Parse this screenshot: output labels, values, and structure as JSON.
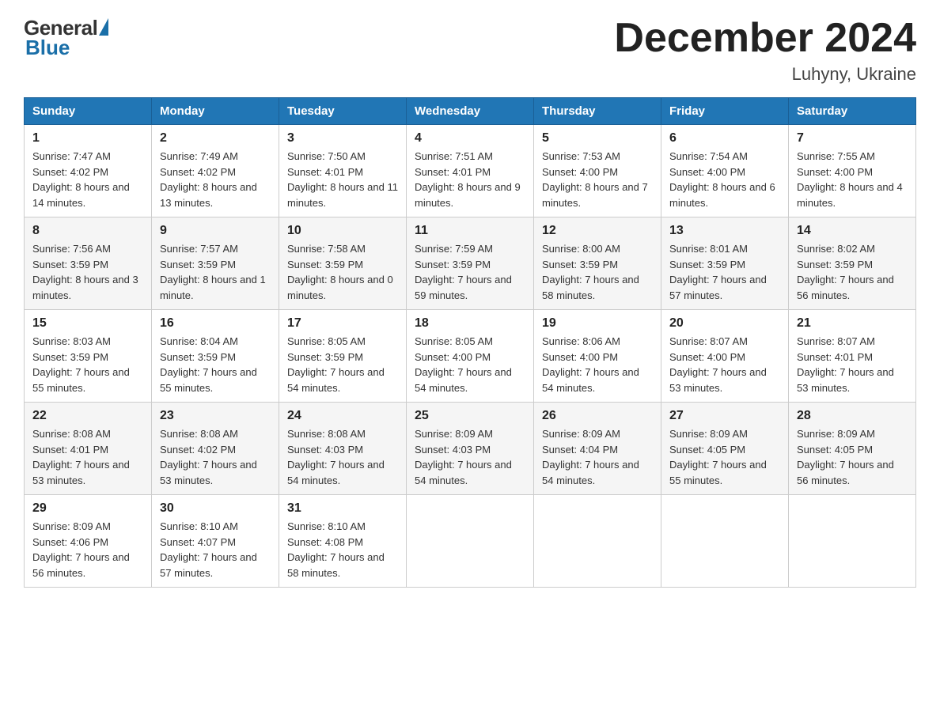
{
  "logo": {
    "general": "General",
    "blue": "Blue"
  },
  "title": "December 2024",
  "location": "Luhyny, Ukraine",
  "days_of_week": [
    "Sunday",
    "Monday",
    "Tuesday",
    "Wednesday",
    "Thursday",
    "Friday",
    "Saturday"
  ],
  "weeks": [
    [
      {
        "day": "1",
        "sunrise": "7:47 AM",
        "sunset": "4:02 PM",
        "daylight": "8 hours and 14 minutes."
      },
      {
        "day": "2",
        "sunrise": "7:49 AM",
        "sunset": "4:02 PM",
        "daylight": "8 hours and 13 minutes."
      },
      {
        "day": "3",
        "sunrise": "7:50 AM",
        "sunset": "4:01 PM",
        "daylight": "8 hours and 11 minutes."
      },
      {
        "day": "4",
        "sunrise": "7:51 AM",
        "sunset": "4:01 PM",
        "daylight": "8 hours and 9 minutes."
      },
      {
        "day": "5",
        "sunrise": "7:53 AM",
        "sunset": "4:00 PM",
        "daylight": "8 hours and 7 minutes."
      },
      {
        "day": "6",
        "sunrise": "7:54 AM",
        "sunset": "4:00 PM",
        "daylight": "8 hours and 6 minutes."
      },
      {
        "day": "7",
        "sunrise": "7:55 AM",
        "sunset": "4:00 PM",
        "daylight": "8 hours and 4 minutes."
      }
    ],
    [
      {
        "day": "8",
        "sunrise": "7:56 AM",
        "sunset": "3:59 PM",
        "daylight": "8 hours and 3 minutes."
      },
      {
        "day": "9",
        "sunrise": "7:57 AM",
        "sunset": "3:59 PM",
        "daylight": "8 hours and 1 minute."
      },
      {
        "day": "10",
        "sunrise": "7:58 AM",
        "sunset": "3:59 PM",
        "daylight": "8 hours and 0 minutes."
      },
      {
        "day": "11",
        "sunrise": "7:59 AM",
        "sunset": "3:59 PM",
        "daylight": "7 hours and 59 minutes."
      },
      {
        "day": "12",
        "sunrise": "8:00 AM",
        "sunset": "3:59 PM",
        "daylight": "7 hours and 58 minutes."
      },
      {
        "day": "13",
        "sunrise": "8:01 AM",
        "sunset": "3:59 PM",
        "daylight": "7 hours and 57 minutes."
      },
      {
        "day": "14",
        "sunrise": "8:02 AM",
        "sunset": "3:59 PM",
        "daylight": "7 hours and 56 minutes."
      }
    ],
    [
      {
        "day": "15",
        "sunrise": "8:03 AM",
        "sunset": "3:59 PM",
        "daylight": "7 hours and 55 minutes."
      },
      {
        "day": "16",
        "sunrise": "8:04 AM",
        "sunset": "3:59 PM",
        "daylight": "7 hours and 55 minutes."
      },
      {
        "day": "17",
        "sunrise": "8:05 AM",
        "sunset": "3:59 PM",
        "daylight": "7 hours and 54 minutes."
      },
      {
        "day": "18",
        "sunrise": "8:05 AM",
        "sunset": "4:00 PM",
        "daylight": "7 hours and 54 minutes."
      },
      {
        "day": "19",
        "sunrise": "8:06 AM",
        "sunset": "4:00 PM",
        "daylight": "7 hours and 54 minutes."
      },
      {
        "day": "20",
        "sunrise": "8:07 AM",
        "sunset": "4:00 PM",
        "daylight": "7 hours and 53 minutes."
      },
      {
        "day": "21",
        "sunrise": "8:07 AM",
        "sunset": "4:01 PM",
        "daylight": "7 hours and 53 minutes."
      }
    ],
    [
      {
        "day": "22",
        "sunrise": "8:08 AM",
        "sunset": "4:01 PM",
        "daylight": "7 hours and 53 minutes."
      },
      {
        "day": "23",
        "sunrise": "8:08 AM",
        "sunset": "4:02 PM",
        "daylight": "7 hours and 53 minutes."
      },
      {
        "day": "24",
        "sunrise": "8:08 AM",
        "sunset": "4:03 PM",
        "daylight": "7 hours and 54 minutes."
      },
      {
        "day": "25",
        "sunrise": "8:09 AM",
        "sunset": "4:03 PM",
        "daylight": "7 hours and 54 minutes."
      },
      {
        "day": "26",
        "sunrise": "8:09 AM",
        "sunset": "4:04 PM",
        "daylight": "7 hours and 54 minutes."
      },
      {
        "day": "27",
        "sunrise": "8:09 AM",
        "sunset": "4:05 PM",
        "daylight": "7 hours and 55 minutes."
      },
      {
        "day": "28",
        "sunrise": "8:09 AM",
        "sunset": "4:05 PM",
        "daylight": "7 hours and 56 minutes."
      }
    ],
    [
      {
        "day": "29",
        "sunrise": "8:09 AM",
        "sunset": "4:06 PM",
        "daylight": "7 hours and 56 minutes."
      },
      {
        "day": "30",
        "sunrise": "8:10 AM",
        "sunset": "4:07 PM",
        "daylight": "7 hours and 57 minutes."
      },
      {
        "day": "31",
        "sunrise": "8:10 AM",
        "sunset": "4:08 PM",
        "daylight": "7 hours and 58 minutes."
      },
      null,
      null,
      null,
      null
    ]
  ],
  "labels": {
    "sunrise_prefix": "Sunrise: ",
    "sunset_prefix": "Sunset: ",
    "daylight_prefix": "Daylight: "
  }
}
